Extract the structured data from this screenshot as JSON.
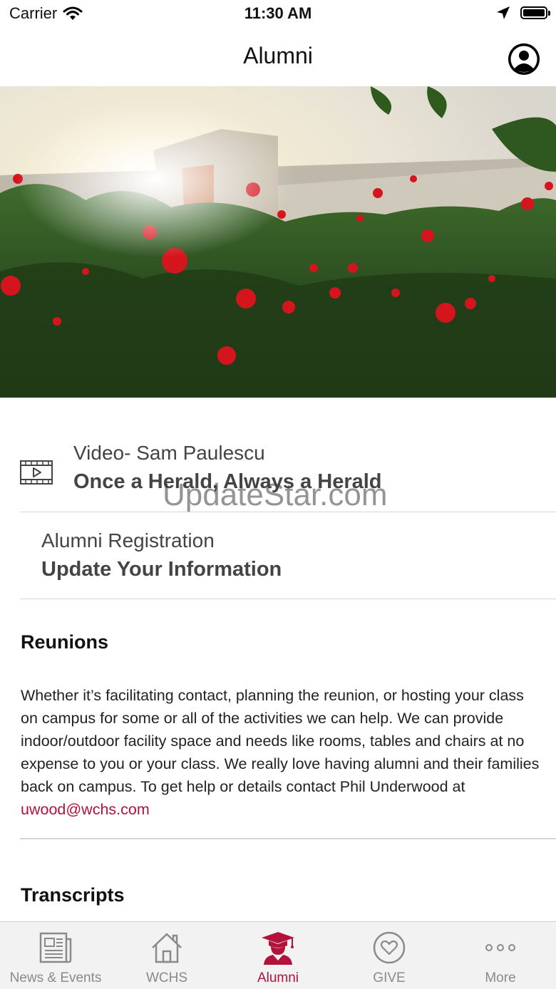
{
  "status_bar": {
    "carrier": "Carrier",
    "time": "11:30 AM"
  },
  "nav": {
    "title": "Alumni"
  },
  "hero": {
    "alt_icon": "campus-roses-photo"
  },
  "items": [
    {
      "title": "Video- Sam Paulescu",
      "subtitle": "Once a Herald, Always a Herald",
      "icon": "video-icon"
    },
    {
      "title": "Alumni Registration",
      "subtitle": "Update Your Information"
    }
  ],
  "reunions": {
    "title": "Reunions",
    "body": "Whether it’s facilitating contact, planning the reunion, or hosting your class on campus for some or all of the activities we can help. We can provide indoor/outdoor facility space and needs like rooms, tables and chairs at no expense to you or your class. We really love having alumni and their families back on campus. To get help or details contact Phil Underwood at ",
    "email": "uwood@wchs.com"
  },
  "transcripts": {
    "title": "Transcripts"
  },
  "watermark": "UpdateStar.com",
  "tabs": [
    {
      "label": "News & Events",
      "icon": "newspaper-icon"
    },
    {
      "label": "WCHS",
      "icon": "home-icon"
    },
    {
      "label": "Alumni",
      "icon": "graduate-icon",
      "active": true
    },
    {
      "label": "GIVE",
      "icon": "heart-icon"
    },
    {
      "label": "More",
      "icon": "more-icon"
    }
  ],
  "colors": {
    "accent": "#b3123b",
    "tab_inactive": "#8a8a8a",
    "tab_bar_bg": "#f2f2f2"
  }
}
